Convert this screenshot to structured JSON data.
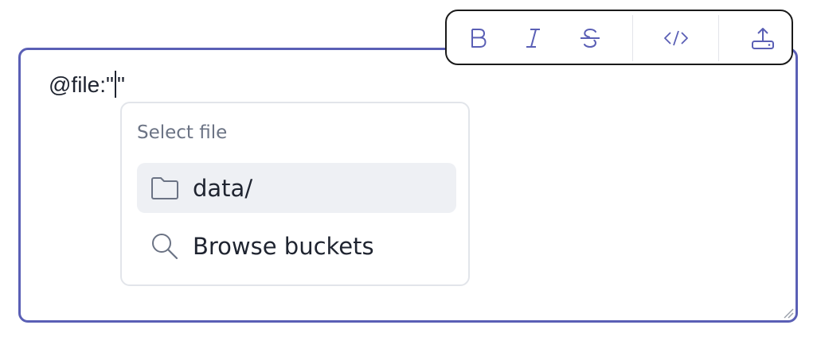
{
  "editor": {
    "text_before_caret": "@file:\"",
    "text_after_caret": "\""
  },
  "toolbar": {
    "buttons": [
      {
        "name": "bold",
        "glyph": "B"
      },
      {
        "name": "italic",
        "glyph": "I"
      },
      {
        "name": "strikethrough",
        "glyph": "S"
      },
      {
        "name": "code",
        "glyph": "</>"
      },
      {
        "name": "upload",
        "icon": "upload-icon"
      }
    ],
    "accent_color": "#5a5fb5"
  },
  "dropdown": {
    "header": "Select file",
    "items": [
      {
        "label": "data/",
        "icon": "folder-icon",
        "selected": true
      },
      {
        "label": "Browse buckets",
        "icon": "search-icon",
        "selected": false
      }
    ]
  },
  "colors": {
    "editor_border": "#5a5fb5",
    "toolbar_border": "#1a1a1a",
    "selected_item_bg": "#eef0f4",
    "icon_color": "#6b7384"
  }
}
